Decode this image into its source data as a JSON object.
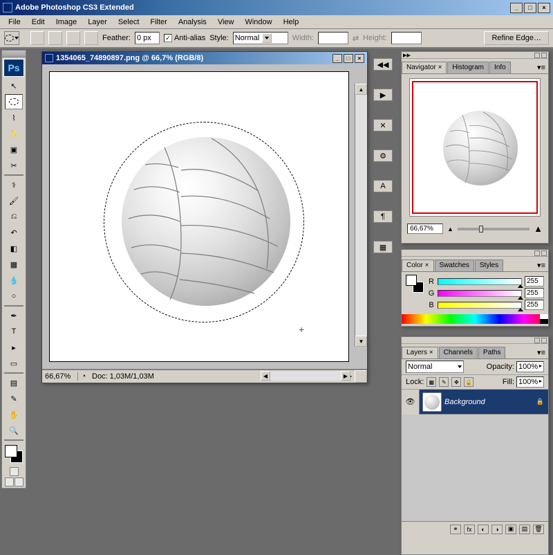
{
  "window": {
    "title": "Adobe Photoshop CS3 Extended",
    "min": "_",
    "max": "□",
    "close": "×"
  },
  "menu": {
    "items": [
      "File",
      "Edit",
      "Image",
      "Layer",
      "Select",
      "Filter",
      "Analysis",
      "View",
      "Window",
      "Help"
    ]
  },
  "options": {
    "feather_label": "Feather:",
    "feather_value": "0 px",
    "antialias_label": "Anti-alias",
    "style_label": "Style:",
    "style_value": "Normal",
    "width_label": "Width:",
    "height_label": "Height:",
    "refine_btn": "Refine Edge…"
  },
  "toolbox": {
    "ps": "Ps"
  },
  "document": {
    "title": "1354065_74890897.png @ 66,7% (RGB/8)",
    "status_zoom": "66,67%",
    "status_info": "Doc: 1,03M/1,03M"
  },
  "navigator": {
    "tabs": [
      "Navigator ×",
      "Histogram",
      "Info"
    ],
    "zoom": "66,67%"
  },
  "color": {
    "tabs": [
      "Color ×",
      "Swatches",
      "Styles"
    ],
    "channels": [
      {
        "label": "R",
        "value": "255",
        "grad": "linear-gradient(to right, #00ffff, #ffffff)"
      },
      {
        "label": "G",
        "value": "255",
        "grad": "linear-gradient(to right, #ff00ff, #ffffff)"
      },
      {
        "label": "B",
        "value": "255",
        "grad": "linear-gradient(to right, #ffff00, #ffffff)"
      }
    ]
  },
  "layers": {
    "tabs": [
      "Layers ×",
      "Channels",
      "Paths"
    ],
    "blend_mode": "Normal",
    "opacity_label": "Opacity:",
    "opacity_value": "100%",
    "lock_label": "Lock:",
    "fill_label": "Fill:",
    "fill_value": "100%",
    "layer_name": "Background"
  }
}
